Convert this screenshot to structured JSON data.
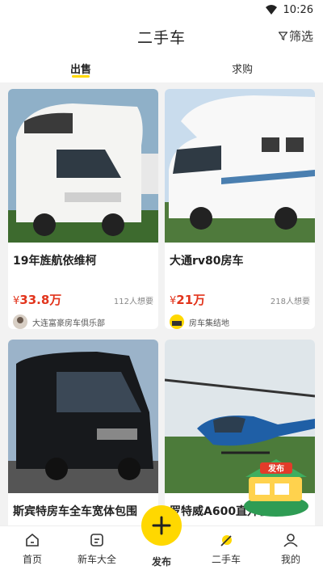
{
  "status": {
    "time": "10:26"
  },
  "nav": {
    "title": "二手车",
    "filter_label": "筛选"
  },
  "tabs": [
    {
      "label": "出售",
      "active": true
    },
    {
      "label": "求购",
      "active": false
    }
  ],
  "listings": [
    {
      "title": "19年旌航依维柯",
      "price_symbol": "¥",
      "price": "33.8万",
      "wants": "112人想要",
      "seller": "大连富豪房车俱乐部"
    },
    {
      "title": "大通rv80房车",
      "price_symbol": "¥",
      "price": "21万",
      "wants": "218人想要",
      "seller": "房车集结地"
    },
    {
      "title": "斯宾特房车全车宽体包围"
    },
    {
      "title": "罗特威A600直升机"
    }
  ],
  "market_badge": "发布",
  "bottom_nav": {
    "home": "首页",
    "new_cars": "新车大全",
    "publish": "发布",
    "used_cars": "二手车",
    "mine": "我的"
  },
  "colors": {
    "accent": "#ffd800",
    "price": "#e2341c"
  }
}
